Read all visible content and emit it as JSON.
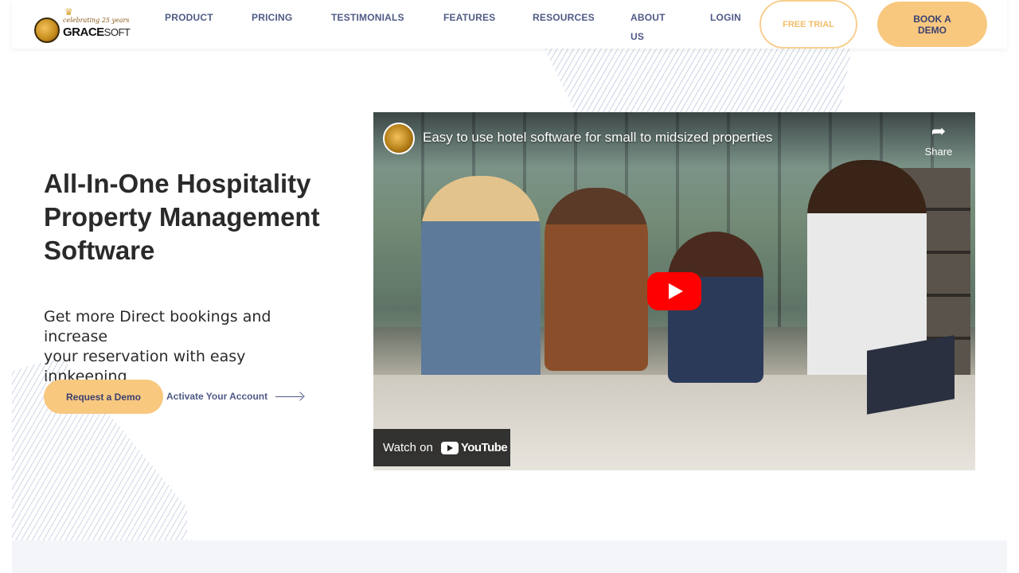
{
  "header": {
    "logo": {
      "tagline": "celebrating 25 years",
      "brand_main": "GRACE",
      "brand_sub": "SOFT"
    },
    "nav": [
      {
        "label": "PRODUCT"
      },
      {
        "label": "PRICING"
      },
      {
        "label": "TESTIMONIALS"
      },
      {
        "label": "FEATURES"
      },
      {
        "label": "RESOURCES"
      },
      {
        "label": "ABOUT US"
      },
      {
        "label": "LOGIN"
      }
    ],
    "free_trial_label": "FREE TRIAL",
    "book_demo_label": "BOOK A DEMO"
  },
  "hero": {
    "title": "All-In-One Hospitality Property Management Software",
    "subtitle_line1": "Get more Direct bookings and increase",
    "subtitle_line2": "your reservation with easy innkeeping",
    "request_demo_label": "Request a Demo",
    "activate_label": "Activate Your Account"
  },
  "video": {
    "title": "Easy to use hotel software for small to midsized properties",
    "share_label": "Share",
    "watch_on_label": "Watch on",
    "youtube_label": "YouTube"
  },
  "colors": {
    "accent": "#f8c87f",
    "nav_text": "#505a86",
    "heading": "#2a2a2a"
  }
}
